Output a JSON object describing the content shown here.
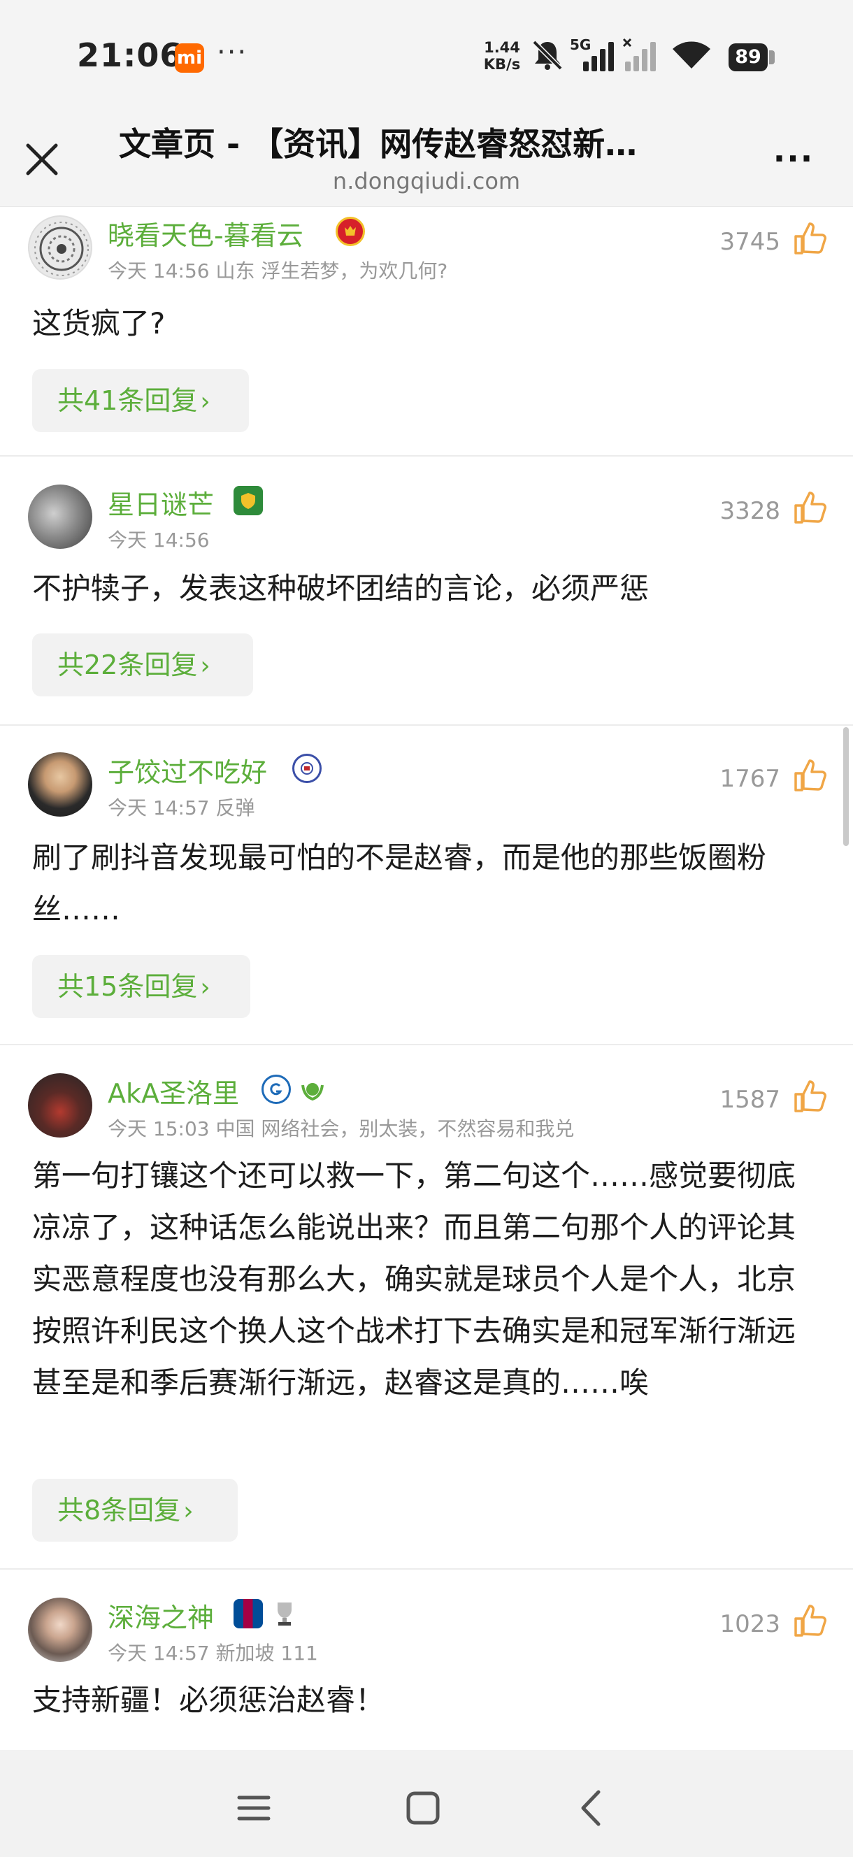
{
  "status_bar": {
    "time": "21:06",
    "carrier_badge": "mi",
    "more_indicator": "···",
    "net_speed_value": "1.44",
    "net_speed_unit": "KB/s",
    "signal_label": "5G",
    "battery": "89",
    "icons": [
      "mute-icon",
      "signal-icon",
      "signal-off-icon",
      "wifi-icon",
      "battery-icon"
    ]
  },
  "title_bar": {
    "title": "文章页 - 【资讯】网传赵睿怒怼新…",
    "url": "n.dongqiudi.com",
    "more_label": "..."
  },
  "comments": [
    {
      "username": "晓看天色-暮看云",
      "meta": "今天 14:56 山东 浮生若梦，为欢几何?",
      "likes": "3745",
      "text": "这货疯了?",
      "replies": "共41条回复"
    },
    {
      "username": "星日谜芒",
      "meta": "今天 14:56",
      "likes": "3328",
      "text": "不护犊子，发表这种破坏团结的言论，必须严惩",
      "replies": "共22条回复"
    },
    {
      "username": "子饺过不吃好",
      "meta": "今天 14:57 反弹",
      "likes": "1767",
      "text": "刷了刷抖音发现最可怕的不是赵睿，而是他的那些饭圈粉丝……",
      "replies": "共15条回复"
    },
    {
      "username": "AkA圣洛里",
      "meta": "今天 15:03 中国 网络社会，别太装，不然容易和我兑",
      "likes": "1587",
      "text": "第一句打镶这个还可以救一下，第二句这个……感觉要彻底凉凉了，这种话怎么能说出来？而且第二句那个人的评论其实恶意程度也没有那么大，确实就是球员个人是个人，北京按照许利民这个换人这个战术打下去确实是和冠军渐行渐远甚至是和季后赛渐行渐远，赵睿这是真的……唉",
      "replies": "共8条回复"
    },
    {
      "username": "深海之神",
      "meta": "今天 14:57 新加坡 111",
      "likes": "1023",
      "text": "支持新疆！必须惩治赵睿！",
      "replies": ""
    }
  ],
  "nav_bar": {
    "buttons": [
      "menu-icon",
      "home-icon",
      "back-icon"
    ]
  },
  "colors": {
    "username": "#5cae3b",
    "like_icon": "#f0a646",
    "meta": "#999999",
    "reply_bg": "#f2f2f2"
  }
}
